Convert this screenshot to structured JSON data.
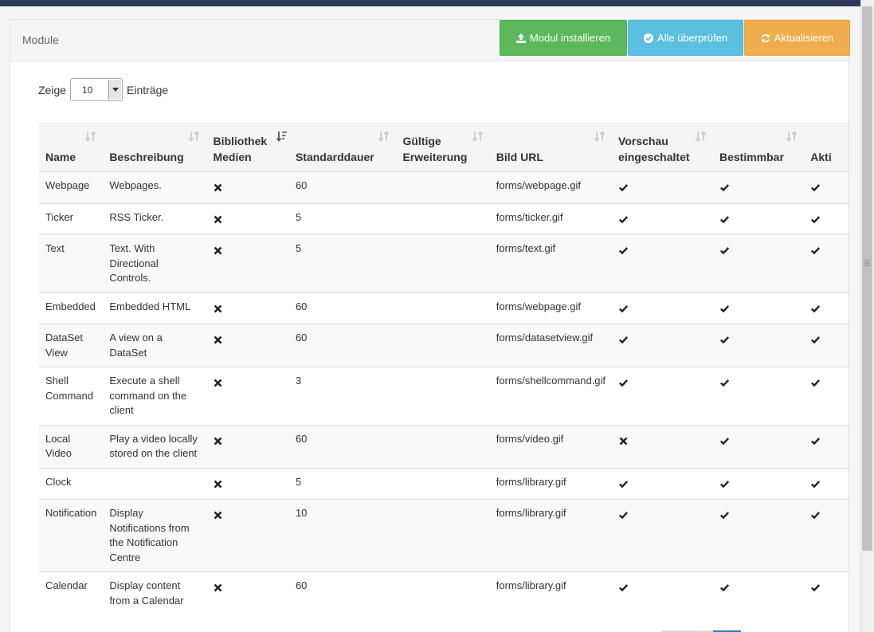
{
  "panel": {
    "title": "Module"
  },
  "buttons": {
    "install": "Modul installieren",
    "verify": "Alle überprüfen",
    "refresh": "Aktualisieren"
  },
  "length": {
    "prefix": "Zeige",
    "value": "10",
    "suffix": "Einträge"
  },
  "table": {
    "headers": {
      "name": "Name",
      "desc": "Beschreibung",
      "lib_1": "Bibliothek",
      "lib_2": "Medien",
      "duration": "Standarddauer",
      "ext_1": "Gültige",
      "ext_2": "Erweiterung",
      "url": "Bild URL",
      "preview_1": "Vorschau",
      "preview_2": "eingeschaltet",
      "assign": "Bestimmbar",
      "active": "Akti"
    },
    "rows": [
      {
        "name": "Webpage",
        "desc": "Webpages.",
        "duration": "60",
        "url": "forms/webpage.gif"
      },
      {
        "name": "Ticker",
        "desc": "RSS Ticker.",
        "duration": "5",
        "url": "forms/ticker.gif"
      },
      {
        "name": "Text",
        "desc": "Text. With Directional Controls.",
        "duration": "5",
        "url": "forms/text.gif"
      },
      {
        "name": "Embedded",
        "desc": "Embedded HTML",
        "duration": "60",
        "url": "forms/webpage.gif"
      },
      {
        "name": "DataSet View",
        "desc": "A view on a DataSet",
        "duration": "60",
        "url": "forms/datasetview.gif"
      },
      {
        "name": "Shell Command",
        "desc": "Execute a shell command on the client",
        "duration": "3",
        "url": "forms/shellcommand.gif"
      },
      {
        "name": "Local Video",
        "desc": "Play a video locally stored on the client",
        "duration": "60",
        "url": "forms/video.gif"
      },
      {
        "name": "Clock",
        "desc": "",
        "duration": "5",
        "url": "forms/library.gif"
      },
      {
        "name": "Notification",
        "desc": "Display Notifications from the Notification Centre",
        "duration": "10",
        "url": "forms/library.gif"
      },
      {
        "name": "Calendar",
        "desc": "Display content from a Calendar",
        "duration": "60",
        "url": "forms/library.gif"
      }
    ],
    "row_icons": [
      {
        "lib": "times-icon",
        "preview": "check-icon",
        "assign": "check-icon",
        "active": "check-icon"
      },
      {
        "lib": "times-icon",
        "preview": "check-icon",
        "assign": "check-icon",
        "active": "check-icon"
      },
      {
        "lib": "times-icon",
        "preview": "check-icon",
        "assign": "check-icon",
        "active": "check-icon"
      },
      {
        "lib": "times-icon",
        "preview": "check-icon",
        "assign": "check-icon",
        "active": "check-icon"
      },
      {
        "lib": "times-icon",
        "preview": "check-icon",
        "assign": "check-icon",
        "active": "check-icon"
      },
      {
        "lib": "times-icon",
        "preview": "check-icon",
        "assign": "check-icon",
        "active": "check-icon"
      },
      {
        "lib": "times-icon",
        "preview": "times-icon",
        "assign": "check-icon",
        "active": "check-icon"
      },
      {
        "lib": "times-icon",
        "preview": "check-icon",
        "assign": "check-icon",
        "active": "check-icon"
      },
      {
        "lib": "times-icon",
        "preview": "check-icon",
        "assign": "check-icon",
        "active": "check-icon"
      },
      {
        "lib": "times-icon",
        "preview": "check-icon",
        "assign": "check-icon",
        "active": "check-icon"
      }
    ]
  },
  "colors": {
    "install": "#5cb85c",
    "verify": "#5bc0de",
    "refresh": "#f0ad4e",
    "topbar": "#2d3a5a"
  }
}
